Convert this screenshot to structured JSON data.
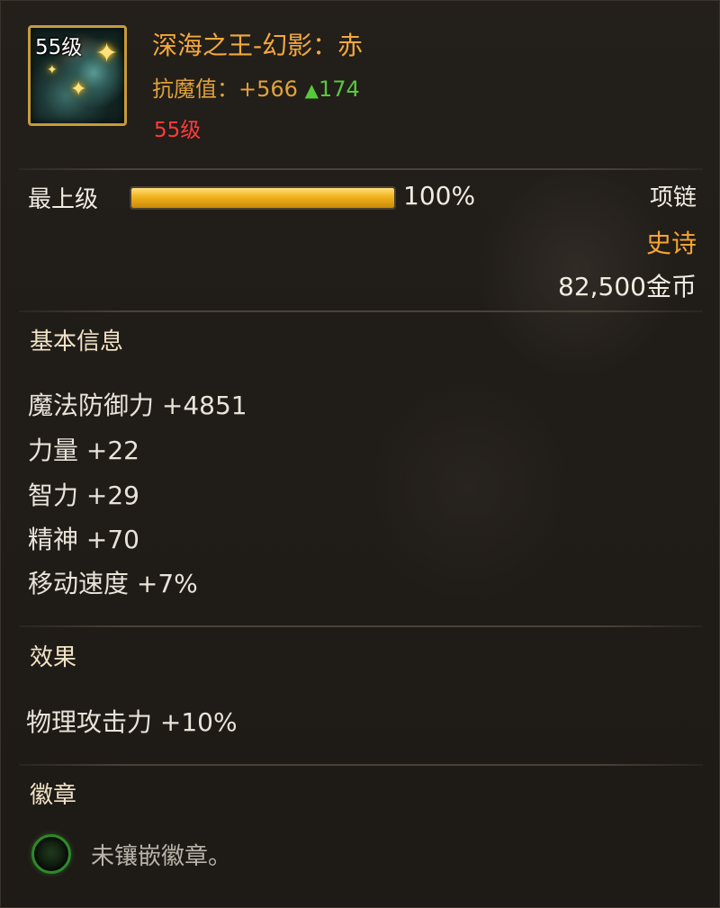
{
  "item": {
    "icon_level": "55级",
    "name": "深海之王-幻影：赤",
    "resist_label": "抗魔值：",
    "resist_value": "+566",
    "resist_delta_arrow": "▲",
    "resist_delta": "174",
    "required_level": "55级",
    "icon": "necklace-icon"
  },
  "enhance": {
    "label": "最上级",
    "progress": 1.0,
    "progress_text": "100%"
  },
  "meta": {
    "slot_type": "项链",
    "rarity": "史诗",
    "rarity_color": "#f6a531",
    "price": "82,500金币"
  },
  "basic_info": {
    "title": "基本信息",
    "stats": [
      "魔法防御力 +4851",
      "力量 +22",
      "智力 +29",
      "精神 +70",
      "移动速度 +7%"
    ]
  },
  "effects": {
    "title": "效果",
    "lines": [
      "物理攻击力 +10%"
    ]
  },
  "emblem": {
    "title": "徽章",
    "socket_icon": "empty-emblem-socket-icon",
    "socket_text": "未镶嵌徽章。"
  },
  "colors": {
    "name": "#f4a93c",
    "resist_delta": "#57c93a",
    "required_level": "#ff3b3b",
    "frame": "#c89a3a"
  }
}
